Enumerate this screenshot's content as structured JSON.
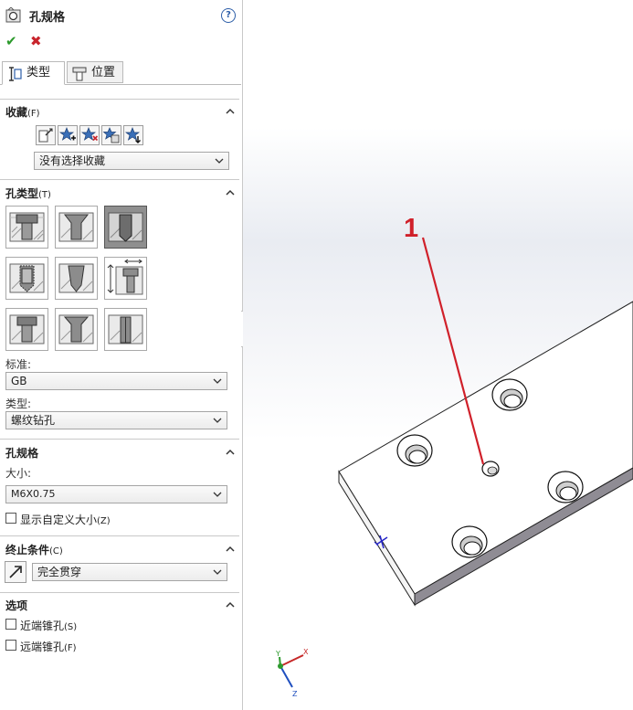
{
  "panel": {
    "title": "孔规格",
    "help": "?",
    "ok_icon": "check-icon",
    "cancel_icon": "x-icon",
    "colors": {
      "ok": "#2c9a2c",
      "cancel": "#c8242c",
      "callout": "#d0202a"
    }
  },
  "tabs": [
    {
      "label": "类型",
      "icon": "type-icon",
      "active": true
    },
    {
      "label": "位置",
      "icon": "position-icon",
      "active": false
    }
  ],
  "favorites": {
    "title": "收藏",
    "accel": "(F)",
    "buttons": [
      "apply-default-icon",
      "add-favorite-icon",
      "delete-favorite-icon",
      "save-favorite-icon",
      "load-favorite-icon"
    ],
    "select_value": "没有选择收藏"
  },
  "hole_type": {
    "title": "孔类型",
    "accel": "(T)",
    "types": [
      {
        "name": "counterbore",
        "selected": false
      },
      {
        "name": "countersink",
        "selected": false
      },
      {
        "name": "hole",
        "selected": true
      },
      {
        "name": "straight-tap",
        "selected": false
      },
      {
        "name": "tapered-tap",
        "selected": false
      },
      {
        "name": "legacy-hole",
        "selected": false
      },
      {
        "name": "counterbore-slot",
        "selected": false
      },
      {
        "name": "countersink-slot",
        "selected": false
      },
      {
        "name": "slot",
        "selected": false
      }
    ],
    "standard_label": "标准:",
    "standard_value": "GB",
    "type_label": "类型:",
    "type_value": "螺纹钻孔"
  },
  "hole_spec": {
    "title": "孔规格",
    "size_label": "大小:",
    "size_value": "M6X0.75",
    "custom_size_label": "显示自定义大小",
    "custom_size_accel": "(Z)",
    "custom_size_checked": false
  },
  "end_condition": {
    "title": "终止条件",
    "accel": "(C)",
    "value": "完全贯穿",
    "reverse_icon": "reverse-direction-icon"
  },
  "options": {
    "title": "选项",
    "near_side": {
      "label": "近端锥孔",
      "accel": "(S)",
      "checked": false
    },
    "far_side": {
      "label": "远端锥孔",
      "accel": "(F)",
      "checked": false
    }
  },
  "viewport": {
    "callout_number": "1",
    "triad": {
      "x": "X",
      "y": "Y",
      "z": "Z"
    }
  }
}
